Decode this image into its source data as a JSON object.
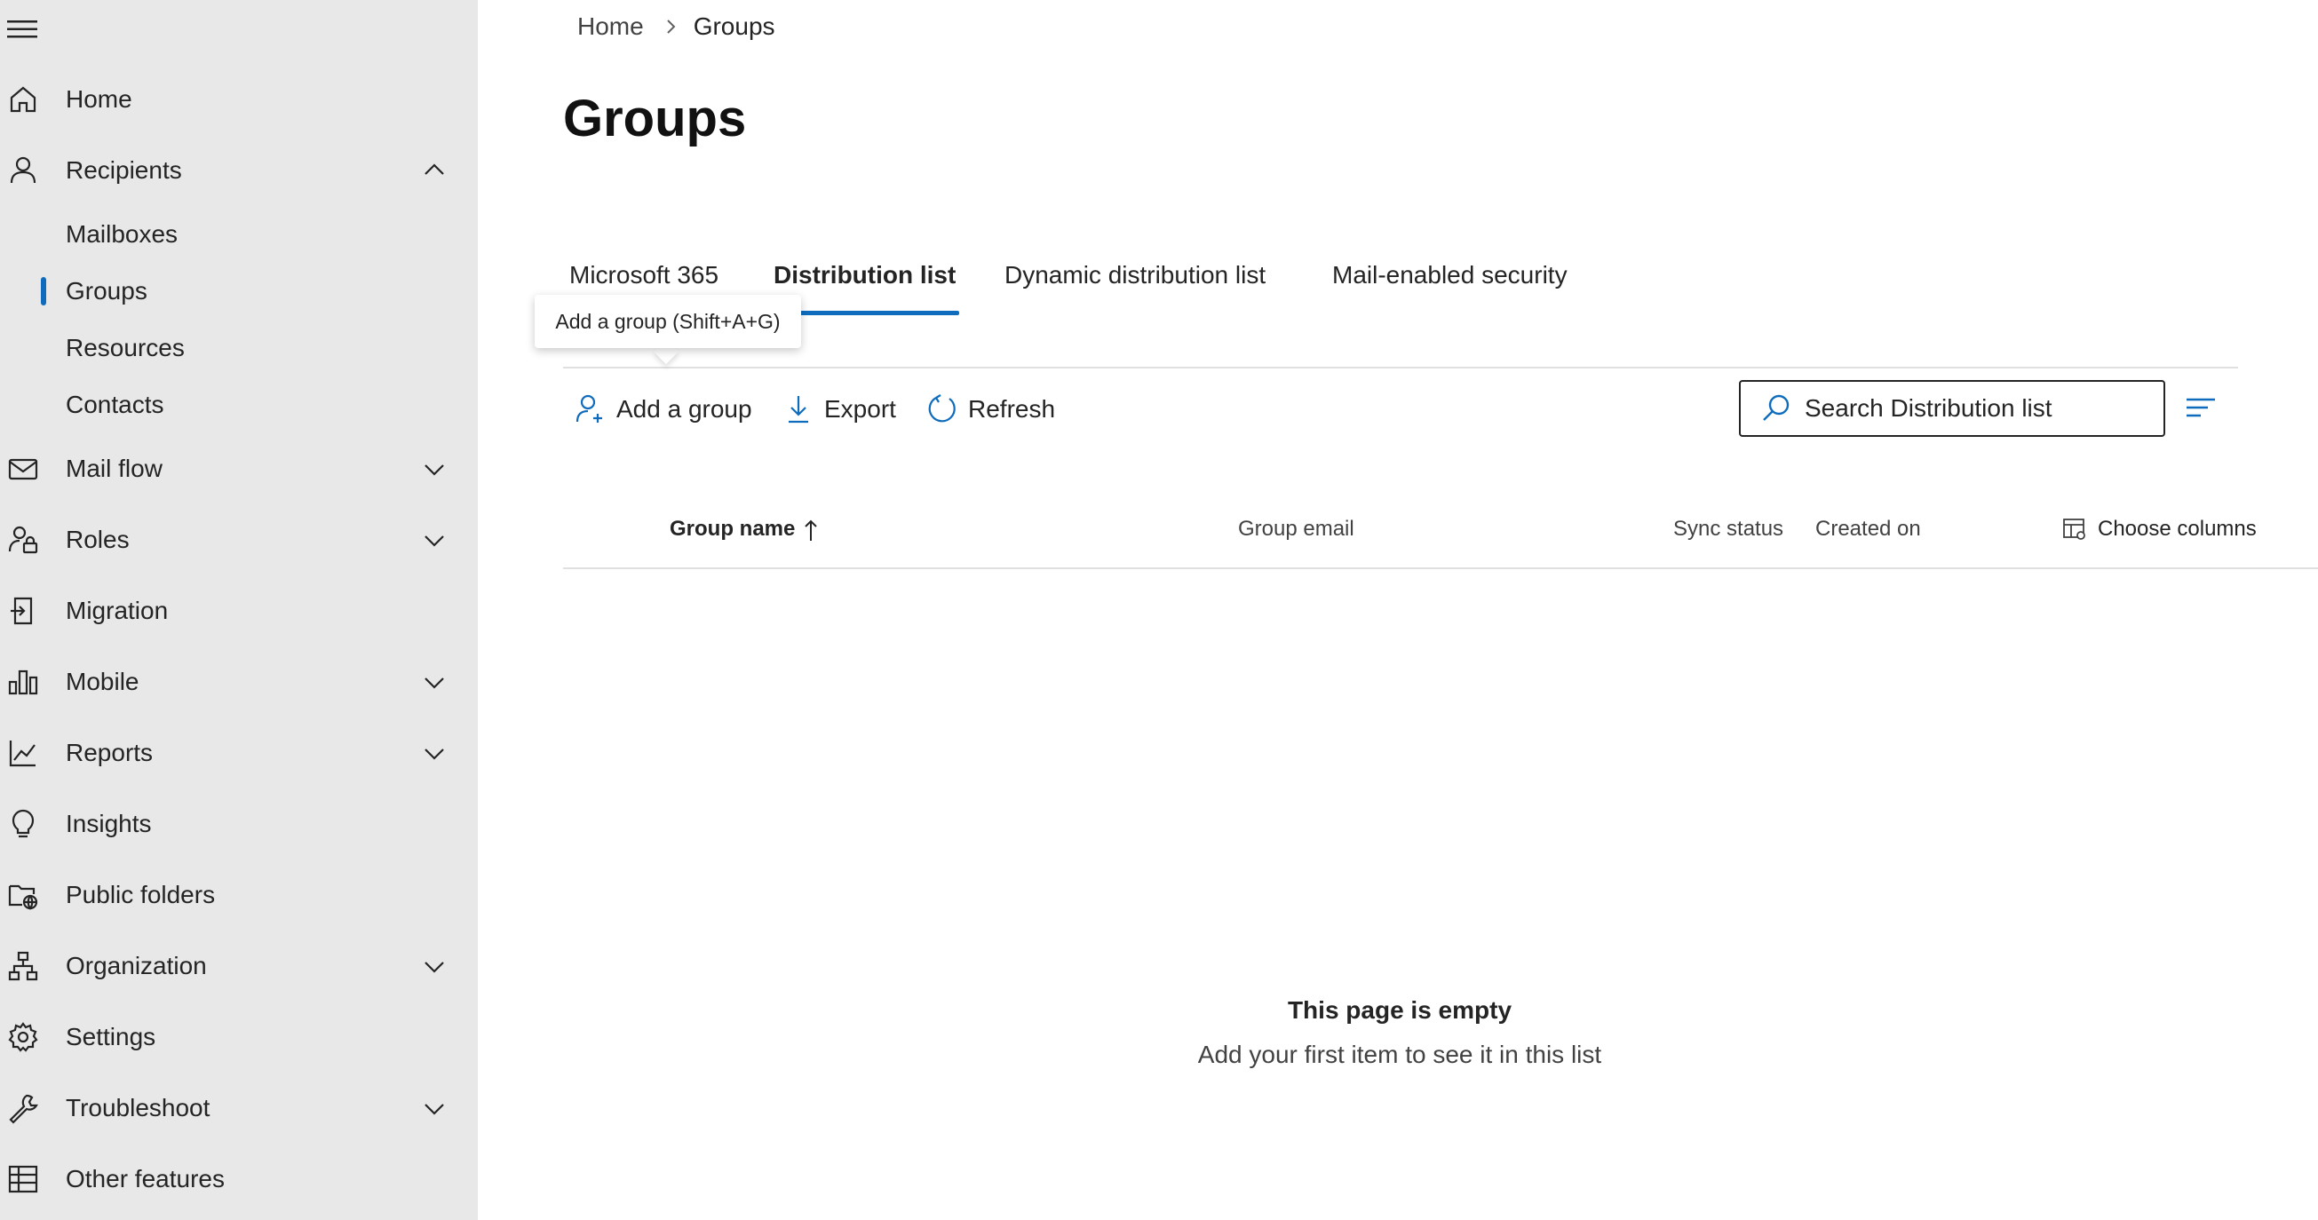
{
  "sidebar": {
    "items": [
      {
        "label": "Home",
        "icon": "home-icon"
      },
      {
        "label": "Recipients",
        "icon": "person-icon",
        "expanded": true
      },
      {
        "label": "Mail flow",
        "icon": "mail-icon"
      },
      {
        "label": "Roles",
        "icon": "roles-icon"
      },
      {
        "label": "Migration",
        "icon": "migration-icon"
      },
      {
        "label": "Mobile",
        "icon": "mobile-icon"
      },
      {
        "label": "Reports",
        "icon": "reports-icon"
      },
      {
        "label": "Insights",
        "icon": "lightbulb-icon"
      },
      {
        "label": "Public folders",
        "icon": "public-folders-icon"
      },
      {
        "label": "Organization",
        "icon": "organization-icon"
      },
      {
        "label": "Settings",
        "icon": "gear-icon"
      },
      {
        "label": "Troubleshoot",
        "icon": "wrench-icon"
      },
      {
        "label": "Other features",
        "icon": "grid-icon"
      }
    ],
    "recipients_sub": [
      "Mailboxes",
      "Groups",
      "Resources",
      "Contacts"
    ],
    "selected_sub": "Groups"
  },
  "breadcrumb": {
    "home": "Home",
    "current": "Groups"
  },
  "page": {
    "title": "Groups"
  },
  "tabs": [
    {
      "label": "Microsoft 365"
    },
    {
      "label": "Distribution list",
      "active": true
    },
    {
      "label": "Dynamic distribution list"
    },
    {
      "label": "Mail-enabled security"
    }
  ],
  "tooltip": "Add a group (Shift+A+G)",
  "commands": {
    "add": "Add a group",
    "export": "Export",
    "refresh": "Refresh"
  },
  "search": {
    "placeholder": "Search Distribution list"
  },
  "table": {
    "columns": [
      "Group name",
      "Group email",
      "Sync status",
      "Created on"
    ],
    "sort_column": "Group name",
    "sort_direction": "ascending",
    "choose_columns": "Choose columns"
  },
  "empty": {
    "title": "This page is empty",
    "subtitle": "Add your first item to see it in this list"
  },
  "colors": {
    "accent": "#0f6cbd",
    "sidebar_bg": "#e8e8e8"
  }
}
